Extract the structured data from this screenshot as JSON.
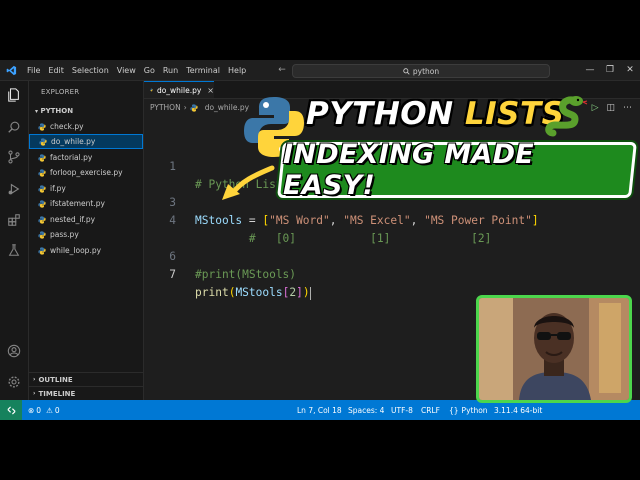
{
  "titlebar": {
    "menu": [
      "File",
      "Edit",
      "Selection",
      "View",
      "Go",
      "Run",
      "Terminal",
      "Help"
    ],
    "search_text": "python"
  },
  "explorer": {
    "title": "EXPLORER",
    "folder": "PYTHON",
    "files": [
      "check.py",
      "do_while.py",
      "factorial.py",
      "forloop_exercise.py",
      "if.py",
      "ifstatement.py",
      "nested_if.py",
      "pass.py",
      "while_loop.py"
    ],
    "active_file": "do_while.py",
    "outline": "OUTLINE",
    "timeline": "TIMELINE"
  },
  "editor": {
    "tab": "do_while.py",
    "breadcrumb": [
      "PYTHON",
      "do_while.py"
    ],
    "lines": [
      {
        "n": "1",
        "text": "# Python List"
      },
      {
        "n": "",
        "text": ""
      },
      {
        "n": "3",
        "text": "MStools = [\"MS Word\", \"MS Excel\", \"MS Power Point\"]"
      },
      {
        "n": "4",
        "text": "        #   [0]           [1]            [2]"
      },
      {
        "n": "",
        "text": ""
      },
      {
        "n": "6",
        "text": "#print(MStools)"
      },
      {
        "n": "7",
        "text": "print(MStools[2])"
      }
    ]
  },
  "statusbar": {
    "errors": "0",
    "warnings": "0",
    "position": "Ln 7, Col 18",
    "spaces": "Spaces: 4",
    "encoding": "UTF-8",
    "eol": "CRLF",
    "language": "Python",
    "interpreter": "3.11.4 64-bit"
  },
  "overlay": {
    "title_part1": "PYTHON ",
    "title_part2": "LISTS",
    "subtitle": "INDEXING MADE EASY!"
  },
  "colors": {
    "accent": "#0078d4",
    "overlay_green": "#1e8a1e",
    "overlay_yellow": "#ffd43b"
  }
}
